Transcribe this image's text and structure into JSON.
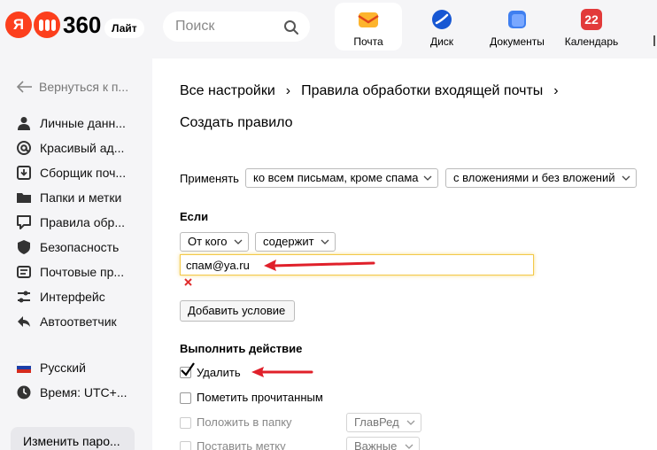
{
  "header": {
    "logo_letter": "Я",
    "logo_text": "360",
    "lite_badge": "Лайт",
    "search_placeholder": "Поиск",
    "services": [
      {
        "label": "Почта",
        "icon": "mail-icon",
        "color": "#fdb42d"
      },
      {
        "label": "Диск",
        "icon": "disk-icon",
        "color": "#1757d3"
      },
      {
        "label": "Документы",
        "icon": "documents-icon",
        "color": "#3f7ff0"
      },
      {
        "label": "Календарь",
        "icon": "calendar-icon",
        "color": "#e23a3a",
        "day": "22"
      }
    ]
  },
  "sidebar": {
    "back_label": "Вернуться к п...",
    "items": [
      {
        "label": "Личные данн...",
        "icon": "person-icon"
      },
      {
        "label": "Красивый ад...",
        "icon": "at-icon"
      },
      {
        "label": "Сборщик поч...",
        "icon": "collector-icon"
      },
      {
        "label": "Папки и метки",
        "icon": "folder-icon"
      },
      {
        "label": "Правила обр...",
        "icon": "filter-icon"
      },
      {
        "label": "Безопасность",
        "icon": "shield-icon"
      },
      {
        "label": "Почтовые пр...",
        "icon": "mail-program-icon"
      },
      {
        "label": "Интерфейс",
        "icon": "sliders-icon"
      },
      {
        "label": "Автоответчик",
        "icon": "reply-icon"
      }
    ],
    "language": "Русский",
    "timezone": "Время: UTC+...",
    "password_button": "Изменить паро..."
  },
  "main": {
    "breadcrumb": [
      "Все настройки",
      "Правила обработки входящей почты"
    ],
    "title": "Создать правило",
    "apply_label": "Применять",
    "apply_scope": "ко всем письмам, кроме спама",
    "apply_attachments": "с вложениями и без вложений",
    "if_label": "Если",
    "condition_field": "От кого",
    "condition_operator": "содержит",
    "condition_value": "спам@ya.ru",
    "add_condition": "Добавить условие",
    "action_label": "Выполнить действие",
    "actions": [
      {
        "label": "Удалить",
        "checked": true
      },
      {
        "label": "Пометить прочитанным",
        "checked": false
      },
      {
        "label": "Положить в папку",
        "checked": false,
        "option": "ГлавРед"
      },
      {
        "label": "Поставить метку",
        "checked": false,
        "option": "Важные"
      }
    ]
  },
  "colors": {
    "brand": "#fc3f1d",
    "annotation_arrow": "#e0202a",
    "focus": "#f3c949"
  }
}
